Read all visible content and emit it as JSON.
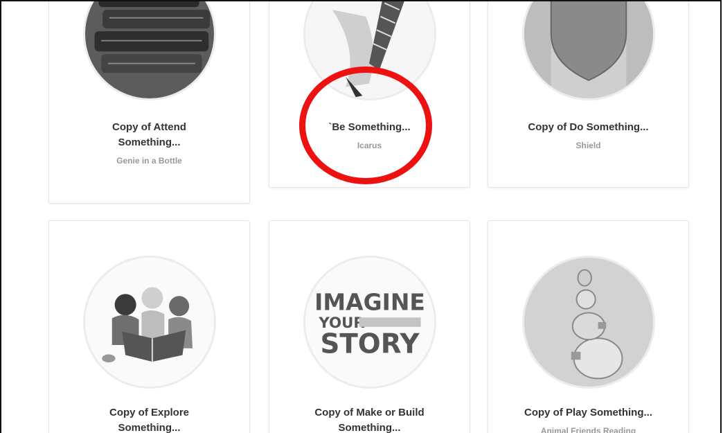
{
  "cards": [
    {
      "title_line1": "Copy of Attend",
      "title_line2": "Something...",
      "subtitle": "Genie in a Bottle",
      "image": "books-stack-illustration"
    },
    {
      "title_line1": "`Be Something...",
      "title_line2": "",
      "subtitle": "Icarus",
      "image": "icarus-illustration"
    },
    {
      "title_line1": "Copy of Do Something...",
      "title_line2": "",
      "subtitle": "Shield",
      "image": "shield-illustration"
    },
    {
      "title_line1": "Copy of Explore",
      "title_line2": "Something...",
      "subtitle": "",
      "image": "children-reading-illustration"
    },
    {
      "title_line1": "Copy of Make or Build",
      "title_line2": "Something...",
      "subtitle": "",
      "image": "imagine-your-story-logo"
    },
    {
      "title_line1": "Copy of Play Something...",
      "title_line2": "",
      "subtitle": "Animal Friends Reading",
      "image": "animal-stack-illustration"
    }
  ],
  "logo": {
    "line1": "IMAGINE",
    "line2": "YOUR",
    "line3": "STORY"
  },
  "annotation_color": "#ee1111"
}
